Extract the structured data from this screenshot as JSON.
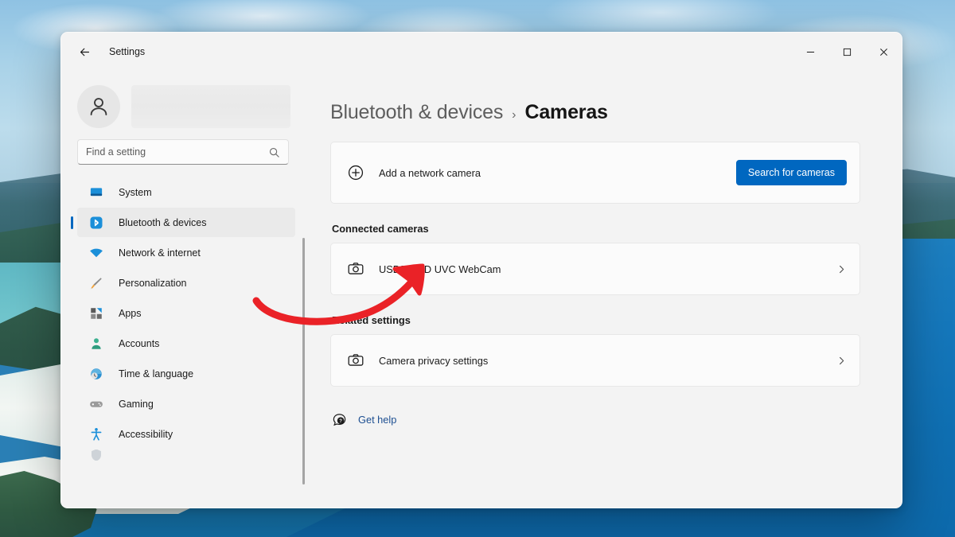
{
  "window": {
    "title": "Settings",
    "back_icon": "back-arrow-icon",
    "controls": {
      "minimize": "minimize-icon",
      "maximize": "maximize-icon",
      "close": "close-icon"
    }
  },
  "sidebar": {
    "account": {
      "avatar_icon": "person-avatar-icon",
      "name_redacted": ""
    },
    "search": {
      "placeholder": "Find a setting",
      "value": "",
      "icon": "search-icon"
    },
    "items": [
      {
        "label": "System",
        "icon": "monitor-icon",
        "selected": false
      },
      {
        "label": "Bluetooth & devices",
        "icon": "bluetooth-icon",
        "selected": true
      },
      {
        "label": "Network & internet",
        "icon": "wifi-icon",
        "selected": false
      },
      {
        "label": "Personalization",
        "icon": "paintbrush-icon",
        "selected": false
      },
      {
        "label": "Apps",
        "icon": "apps-grid-icon",
        "selected": false
      },
      {
        "label": "Accounts",
        "icon": "person-icon",
        "selected": false
      },
      {
        "label": "Time & language",
        "icon": "clock-globe-icon",
        "selected": false
      },
      {
        "label": "Gaming",
        "icon": "gamepad-icon",
        "selected": false
      },
      {
        "label": "Accessibility",
        "icon": "accessibility-icon",
        "selected": false
      }
    ]
  },
  "content": {
    "breadcrumb": {
      "parent": "Bluetooth & devices",
      "separator": "›",
      "current": "Cameras"
    },
    "add_camera": {
      "icon": "plus-circle-icon",
      "label": "Add a network camera",
      "button_label": "Search for cameras"
    },
    "connected_cameras": {
      "section_title": "Connected cameras",
      "items": [
        {
          "icon": "camera-icon",
          "label": "USB2.0 HD UVC WebCam",
          "chevron": "chevron-right-icon"
        }
      ]
    },
    "related_settings": {
      "section_title": "Related settings",
      "items": [
        {
          "icon": "camera-icon",
          "label": "Camera privacy settings",
          "chevron": "chevron-right-icon"
        }
      ]
    },
    "get_help": {
      "icon": "help-bubble-icon",
      "label": "Get help"
    }
  },
  "annotation": {
    "type": "curved-arrow",
    "color": "#ea2227",
    "points_to": "USB2.0 HD UVC WebCam"
  },
  "colors": {
    "accent": "#0067c0",
    "window_bg": "#f3f3f3",
    "card_bg": "#fbfbfb",
    "selected_nav_bg": "#eaeaea",
    "link": "#1d4f91",
    "annotation_red": "#ea2227"
  }
}
